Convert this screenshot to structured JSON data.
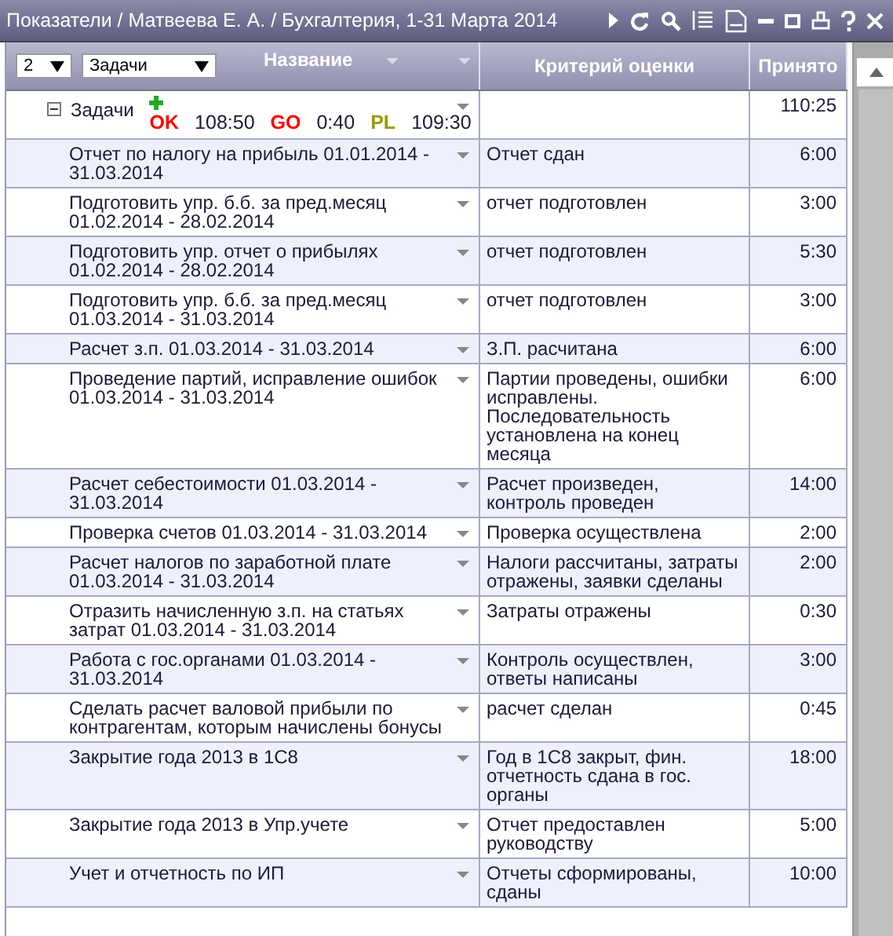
{
  "window": {
    "title": "Показатели / Матвеева Е. А. / Бухгалтерия, 1-31 Марта 2014"
  },
  "header": {
    "level_select": "2",
    "type_select": "Задачи",
    "columns": [
      "Название",
      "Критерий оценки",
      "Принято"
    ]
  },
  "group": {
    "name": "Задачи",
    "expanded": true,
    "accepted": "110:25",
    "stats": [
      {
        "label": "OK",
        "value": "108:50",
        "color": "#ff0000"
      },
      {
        "label": "GO",
        "value": "0:40",
        "color": "#ff0000"
      },
      {
        "label": "PL",
        "value": "109:30",
        "color": "#999900"
      }
    ]
  },
  "rows": [
    {
      "name": "Отчет по налогу на прибыль 01.01.2014 - 31.03.2014",
      "criterion": "Отчет сдан",
      "accepted": "6:00"
    },
    {
      "name": "Подготовить упр. б.б. за пред.месяц 01.02.2014 - 28.02.2014",
      "criterion": "отчет подготовлен",
      "accepted": "3:00"
    },
    {
      "name": "Подготовить упр. отчет о прибылях 01.02.2014 - 28.02.2014",
      "criterion": "отчет подготовлен",
      "accepted": "5:30"
    },
    {
      "name": "Подготовить упр. б.б. за пред.месяц 01.03.2014 - 31.03.2014",
      "criterion": "отчет подготовлен",
      "accepted": "3:00"
    },
    {
      "name": "Расчет з.п. 01.03.2014 - 31.03.2014",
      "criterion": "З.П. расчитана",
      "accepted": "6:00"
    },
    {
      "name": "Проведение партий, исправление ошибок 01.03.2014 - 31.03.2014",
      "criterion": "Партии проведены, ошибки исправлены. Последовательность установлена на конец месяца",
      "accepted": "6:00"
    },
    {
      "name": "Расчет себестоимости 01.03.2014 - 31.03.2014",
      "criterion": "Расчет произведен, контроль проведен",
      "accepted": "14:00"
    },
    {
      "name": "Проверка счетов 01.03.2014 - 31.03.2014",
      "criterion": "Проверка осуществлена",
      "accepted": "2:00"
    },
    {
      "name": "Расчет налогов по заработной плате 01.03.2014 - 31.03.2014",
      "criterion": "Налоги рассчитаны, затраты отражены, заявки сделаны",
      "accepted": "2:00"
    },
    {
      "name": "Отразить начисленную з.п. на статьях затрат 01.03.2014 - 31.03.2014",
      "criterion": "Затраты отражены",
      "accepted": "0:30"
    },
    {
      "name": "Работа с гос.органами 01.03.2014 - 31.03.2014",
      "criterion": "Контроль осуществлен, ответы написаны",
      "accepted": "3:00"
    },
    {
      "name": "Сделать расчет валовой прибыли по контрагентам, которым начислены бонусы",
      "criterion": "расчет сделан",
      "accepted": "0:45"
    },
    {
      "name": "Закрытие года 2013 в 1С8",
      "criterion": "Год в 1С8 закрыт, фин. отчетность сдана в гос. органы",
      "accepted": "18:00"
    },
    {
      "name": "Закрытие года 2013 в Упр.учете",
      "criterion": "Отчет предоставлен руководству",
      "accepted": "5:00"
    },
    {
      "name": "Учет и отчетность по ИП",
      "criterion": "Отчеты сформированы, сданы",
      "accepted": "10:00"
    }
  ]
}
